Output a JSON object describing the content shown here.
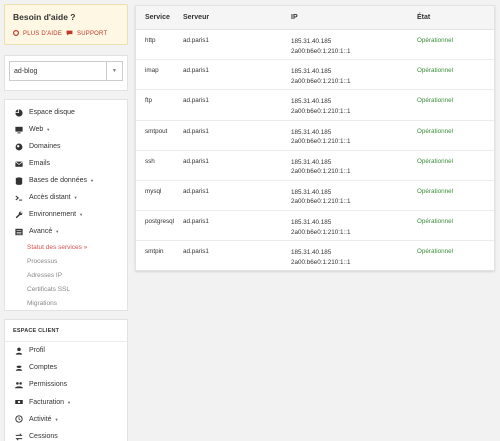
{
  "help": {
    "title": "Besoin d'aide ?",
    "plus_label": "PLUS D'AIDE",
    "support_label": "SUPPORT"
  },
  "account_select": {
    "value": "ad-blog"
  },
  "menu": {
    "items": [
      {
        "label": "Espace disque",
        "icon": "pie-chart-icon"
      },
      {
        "label": "Web",
        "icon": "monitor-icon",
        "caret": true
      },
      {
        "label": "Domaines",
        "icon": "globe-icon"
      },
      {
        "label": "Emails",
        "icon": "envelope-icon"
      },
      {
        "label": "Bases de données",
        "icon": "database-icon",
        "caret": true
      },
      {
        "label": "Accès distant",
        "icon": "terminal-icon",
        "caret": true
      },
      {
        "label": "Environnement",
        "icon": "wrench-icon",
        "caret": true
      },
      {
        "label": "Avancé",
        "icon": "list-icon",
        "caret": true
      }
    ],
    "subitems": [
      {
        "label": "Statut des services »",
        "active": true
      },
      {
        "label": "Processus"
      },
      {
        "label": "Adresses IP"
      },
      {
        "label": "Certificats SSL"
      },
      {
        "label": "Migrations"
      }
    ]
  },
  "client": {
    "heading": "ESPACE CLIENT",
    "items": [
      {
        "label": "Profil",
        "icon": "user-icon"
      },
      {
        "label": "Comptes",
        "icon": "account-icon"
      },
      {
        "label": "Permissions",
        "icon": "users-icon"
      },
      {
        "label": "Facturation",
        "icon": "money-icon",
        "caret": true
      },
      {
        "label": "Activité",
        "icon": "history-icon",
        "caret": true
      },
      {
        "label": "Cessions",
        "icon": "exchange-icon"
      }
    ]
  },
  "table": {
    "headers": [
      "Service",
      "Serveur",
      "IP",
      "État"
    ],
    "rows": [
      {
        "service": "http",
        "server": "ad.paris1",
        "ipv4": "185.31.40.185",
        "ipv6": "2a00:b6e0:1:210:1::1",
        "status": "Opérationnel"
      },
      {
        "service": "imap",
        "server": "ad.paris1",
        "ipv4": "185.31.40.185",
        "ipv6": "2a00:b6e0:1:210:1::1",
        "status": "Opérationnel"
      },
      {
        "service": "ftp",
        "server": "ad.paris1",
        "ipv4": "185.31.40.185",
        "ipv6": "2a00:b6e0:1:210:1::1",
        "status": "Opérationnel"
      },
      {
        "service": "smtpout",
        "server": "ad.paris1",
        "ipv4": "185.31.40.185",
        "ipv6": "2a00:b6e0:1:210:1::1",
        "status": "Opérationnel"
      },
      {
        "service": "ssh",
        "server": "ad.paris1",
        "ipv4": "185.31.40.185",
        "ipv6": "2a00:b6e0:1:210:1::1",
        "status": "Opérationnel"
      },
      {
        "service": "mysql",
        "server": "ad.paris1",
        "ipv4": "185.31.40.185",
        "ipv6": "2a00:b6e0:1:210:1::1",
        "status": "Opérationnel"
      },
      {
        "service": "postgresql",
        "server": "ad.paris1",
        "ipv4": "185.31.40.185",
        "ipv6": "2a00:b6e0:1:210:1::1",
        "status": "Opérationnel"
      },
      {
        "service": "smtpin",
        "server": "ad.paris1",
        "ipv4": "185.31.40.185",
        "ipv6": "2a00:b6e0:1:210:1::1",
        "status": "Opérationnel"
      }
    ]
  },
  "colors": {
    "accent": "#d9534f",
    "status_ok": "#3c8f3c",
    "help_bg": "#fdf7e3"
  }
}
